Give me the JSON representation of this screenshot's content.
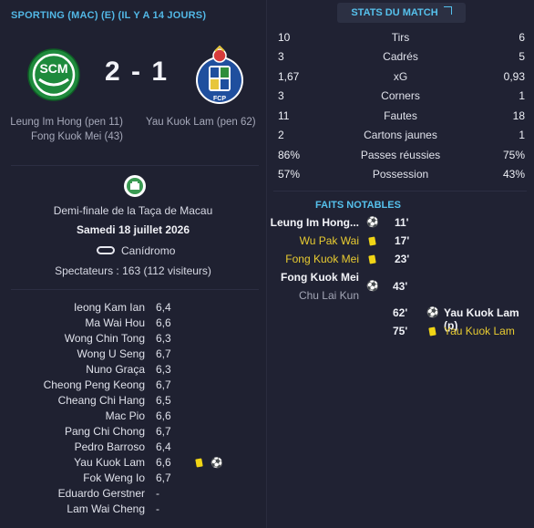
{
  "header": {
    "title": "SPORTING (MAC) (E) (IL Y A 14 JOURS)"
  },
  "score": {
    "text": "2 - 1"
  },
  "home_team": {
    "crest_text": "SCM",
    "scorers": [
      "Leung Im Hong (pen 11)",
      "Fong Kuok Mei (43)"
    ],
    "color": "#1e8a3c"
  },
  "away_team": {
    "crest_text": "FCP",
    "scorers": [
      "Yau Kuok Lam (pen 62)"
    ],
    "color": "#1f4f9e"
  },
  "match_info": {
    "competition": "Demi-finale de la Taça de Macau",
    "date": "Samedi 18 juillet 2026",
    "stadium": "Canídromo",
    "attendance": "Spectateurs : 163 (112 visiteurs)"
  },
  "players": [
    {
      "name": "Ieong Kam Ian",
      "rating": "6,4"
    },
    {
      "name": "Ma Wai Hou",
      "rating": "6,6"
    },
    {
      "name": "Wong Chin Tong",
      "rating": "6,3"
    },
    {
      "name": "Wong U Seng",
      "rating": "6,7"
    },
    {
      "name": "Nuno Graça",
      "rating": "6,3"
    },
    {
      "name": "Cheong Peng Keong",
      "rating": "6,7"
    },
    {
      "name": "Cheang Chi Hang",
      "rating": "6,5"
    },
    {
      "name": "Mac Pio",
      "rating": "6,6"
    },
    {
      "name": "Pang Chi Chong",
      "rating": "6,7"
    },
    {
      "name": "Pedro Barroso",
      "rating": "6,4"
    },
    {
      "name": "Yau Kuok Lam",
      "rating": "6,6",
      "yellow_card": true,
      "goal": true
    },
    {
      "name": "Fok Weng Io",
      "rating": "6,7"
    },
    {
      "name": "Eduardo Gerstner",
      "rating": "-"
    },
    {
      "name": "Lam Wai Cheng",
      "rating": "-"
    }
  ],
  "stats_button": {
    "label": "STATS DU MATCH"
  },
  "stats": [
    {
      "label": "Tirs",
      "home": "10",
      "away": "6"
    },
    {
      "label": "Cadrés",
      "home": "3",
      "away": "5"
    },
    {
      "label": "xG",
      "home": "1,67",
      "away": "0,93"
    },
    {
      "label": "Corners",
      "home": "3",
      "away": "1"
    },
    {
      "label": "Fautes",
      "home": "11",
      "away": "18"
    },
    {
      "label": "Cartons jaunes",
      "home": "2",
      "away": "1"
    },
    {
      "label": "Passes réussies",
      "home": "86%",
      "away": "75%"
    },
    {
      "label": "Possession",
      "home": "57%",
      "away": "43%"
    }
  ],
  "faits": {
    "title": "FAITS NOTABLES",
    "events": [
      {
        "side": "home",
        "player": "Leung Im Hong...",
        "type": "goal",
        "minute": "11'"
      },
      {
        "side": "home",
        "player": "Wu Pak Wai",
        "type": "yellow",
        "minute": "17'"
      },
      {
        "side": "home",
        "player": "Fong Kuok Mei",
        "type": "yellow",
        "minute": "23'"
      },
      {
        "side": "home",
        "player": "Fong Kuok Mei",
        "assist": "Chu Lai Kun",
        "type": "goal",
        "minute": "43'"
      },
      {
        "side": "away",
        "player": "Yau Kuok Lam (p)",
        "type": "goal",
        "minute": "62'"
      },
      {
        "side": "away",
        "player": "Yau Kuok Lam",
        "type": "yellow",
        "minute": "75'"
      }
    ]
  },
  "colors": {
    "accent": "#52b8e6",
    "yellow_card": "#f1d515",
    "yellow_text": "#e9cc31"
  }
}
